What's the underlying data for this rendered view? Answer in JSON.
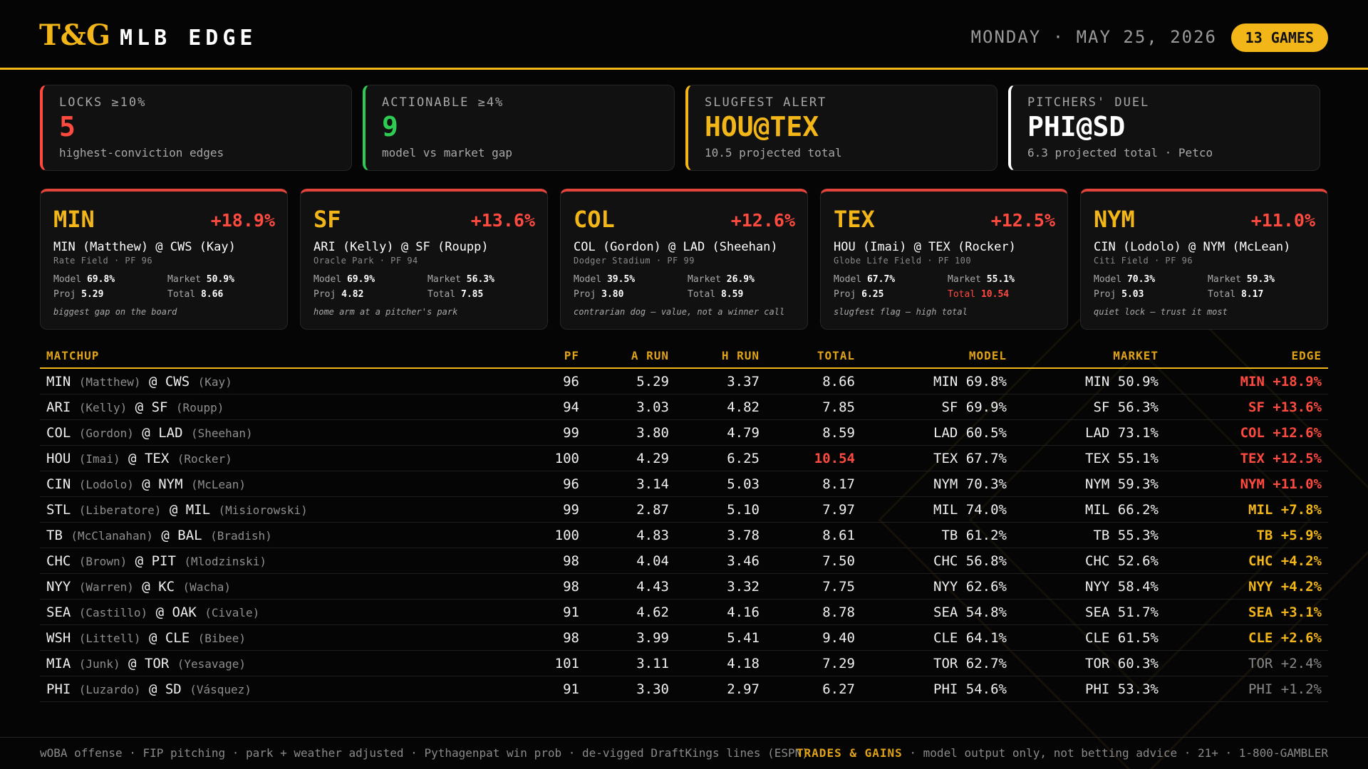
{
  "header": {
    "logo": "T&G",
    "title": "MLB EDGE",
    "date": "MONDAY · MAY 25, 2026",
    "games_badge": "13 GAMES"
  },
  "stats": [
    {
      "label": "LOCKS ≥10%",
      "value": "5",
      "sub": "highest-conviction edges",
      "color": "#ff4a40"
    },
    {
      "label": "ACTIONABLE ≥4%",
      "value": "9",
      "sub": "model vs market gap",
      "color": "#2ecc52"
    },
    {
      "label": "SLUGFEST ALERT",
      "value": "HOU@TEX",
      "sub": "10.5 projected total",
      "color": "#f2b619"
    },
    {
      "label": "PITCHERS' DUEL",
      "value": "PHI@SD",
      "sub": "6.3 projected total · Petco",
      "color": "#ffffff"
    }
  ],
  "cards": [
    {
      "team": "MIN",
      "edge": "+18.9%",
      "match": "MIN (Matthew) @ CWS (Kay)",
      "venue": "Rate Field · PF 96",
      "model_label": "Model",
      "model": "69.8%",
      "market_label": "Market",
      "market": "50.9%",
      "proj_label": "Proj",
      "proj": "5.29",
      "total_label": "Total",
      "total": "8.66",
      "note": "biggest gap on the board"
    },
    {
      "team": "SF",
      "edge": "+13.6%",
      "match": "ARI (Kelly) @ SF (Roupp)",
      "venue": "Oracle Park · PF 94",
      "model_label": "Model",
      "model": "69.9%",
      "market_label": "Market",
      "market": "56.3%",
      "proj_label": "Proj",
      "proj": "4.82",
      "total_label": "Total",
      "total": "7.85",
      "note": "home arm at a pitcher's park"
    },
    {
      "team": "COL",
      "edge": "+12.6%",
      "match": "COL (Gordon) @ LAD (Sheehan)",
      "venue": "Dodger Stadium · PF 99",
      "model_label": "Model",
      "model": "39.5%",
      "market_label": "Market",
      "market": "26.9%",
      "proj_label": "Proj",
      "proj": "3.80",
      "total_label": "Total",
      "total": "8.59",
      "note": "contrarian dog — value, not a winner call"
    },
    {
      "team": "TEX",
      "edge": "+12.5%",
      "match": "HOU (Imai) @ TEX (Rocker)",
      "venue": "Globe Life Field · PF 100",
      "model_label": "Model",
      "model": "67.7%",
      "market_label": "Market",
      "market": "55.1%",
      "proj_label": "Proj",
      "proj": "6.25",
      "total_label": "Total",
      "total": "10.54",
      "note": "slugfest flag — high total",
      "total_red": true
    },
    {
      "team": "NYM",
      "edge": "+11.0%",
      "match": "CIN (Lodolo) @ NYM (McLean)",
      "venue": "Citi Field · PF 96",
      "model_label": "Model",
      "model": "70.3%",
      "market_label": "Market",
      "market": "59.3%",
      "proj_label": "Proj",
      "proj": "5.03",
      "total_label": "Total",
      "total": "8.17",
      "note": "quiet lock — trust it most"
    }
  ],
  "table": {
    "headers": {
      "matchup": "MATCHUP",
      "pf": "PF",
      "a_run": "A RUN",
      "h_run": "H RUN",
      "total": "TOTAL",
      "model": "MODEL",
      "market": "MARKET",
      "edge": "EDGE"
    },
    "rows": [
      {
        "away": "MIN",
        "away_p": "(Matthew)",
        "at": "@",
        "home": "CWS",
        "home_p": "(Kay)",
        "pf": "96",
        "a_run": "5.29",
        "h_run": "3.37",
        "total": "8.66",
        "model": "MIN 69.8%",
        "market": "MIN 50.9%",
        "edge": "MIN +18.9%",
        "tier": "red"
      },
      {
        "away": "ARI",
        "away_p": "(Kelly)",
        "at": "@",
        "home": "SF",
        "home_p": "(Roupp)",
        "pf": "94",
        "a_run": "3.03",
        "h_run": "4.82",
        "total": "7.85",
        "model": "SF 69.9%",
        "market": "SF 56.3%",
        "edge": "SF +13.6%",
        "tier": "red"
      },
      {
        "away": "COL",
        "away_p": "(Gordon)",
        "at": "@",
        "home": "LAD",
        "home_p": "(Sheehan)",
        "pf": "99",
        "a_run": "3.80",
        "h_run": "4.79",
        "total": "8.59",
        "model": "LAD 60.5%",
        "market": "LAD 73.1%",
        "edge": "COL +12.6%",
        "tier": "red"
      },
      {
        "away": "HOU",
        "away_p": "(Imai)",
        "at": "@",
        "home": "TEX",
        "home_p": "(Rocker)",
        "pf": "100",
        "a_run": "4.29",
        "h_run": "6.25",
        "total": "10.54",
        "model": "TEX 67.7%",
        "market": "TEX 55.1%",
        "edge": "TEX +12.5%",
        "tier": "red",
        "total_red": true
      },
      {
        "away": "CIN",
        "away_p": "(Lodolo)",
        "at": "@",
        "home": "NYM",
        "home_p": "(McLean)",
        "pf": "96",
        "a_run": "3.14",
        "h_run": "5.03",
        "total": "8.17",
        "model": "NYM 70.3%",
        "market": "NYM 59.3%",
        "edge": "NYM +11.0%",
        "tier": "red"
      },
      {
        "away": "STL",
        "away_p": "(Liberatore)",
        "at": "@",
        "home": "MIL",
        "home_p": "(Misiorowski)",
        "pf": "99",
        "a_run": "2.87",
        "h_run": "5.10",
        "total": "7.97",
        "model": "MIL 74.0%",
        "market": "MIL 66.2%",
        "edge": "MIL +7.8%",
        "tier": "gold"
      },
      {
        "away": "TB",
        "away_p": "(McClanahan)",
        "at": "@",
        "home": "BAL",
        "home_p": "(Bradish)",
        "pf": "100",
        "a_run": "4.83",
        "h_run": "3.78",
        "total": "8.61",
        "model": "TB 61.2%",
        "market": "TB 55.3%",
        "edge": "TB +5.9%",
        "tier": "gold"
      },
      {
        "away": "CHC",
        "away_p": "(Brown)",
        "at": "@",
        "home": "PIT",
        "home_p": "(Mlodzinski)",
        "pf": "98",
        "a_run": "4.04",
        "h_run": "3.46",
        "total": "7.50",
        "model": "CHC 56.8%",
        "market": "CHC 52.6%",
        "edge": "CHC +4.2%",
        "tier": "gold"
      },
      {
        "away": "NYY",
        "away_p": "(Warren)",
        "at": "@",
        "home": "KC",
        "home_p": "(Wacha)",
        "pf": "98",
        "a_run": "4.43",
        "h_run": "3.32",
        "total": "7.75",
        "model": "NYY 62.6%",
        "market": "NYY 58.4%",
        "edge": "NYY +4.2%",
        "tier": "gold"
      },
      {
        "away": "SEA",
        "away_p": "(Castillo)",
        "at": "@",
        "home": "OAK",
        "home_p": "(Civale)",
        "pf": "91",
        "a_run": "4.62",
        "h_run": "4.16",
        "total": "8.78",
        "model": "SEA 54.8%",
        "market": "SEA 51.7%",
        "edge": "SEA +3.1%",
        "tier": "gold"
      },
      {
        "away": "WSH",
        "away_p": "(Littell)",
        "at": "@",
        "home": "CLE",
        "home_p": "(Bibee)",
        "pf": "98",
        "a_run": "3.99",
        "h_run": "5.41",
        "total": "9.40",
        "model": "CLE 64.1%",
        "market": "CLE 61.5%",
        "edge": "CLE +2.6%",
        "tier": "gold"
      },
      {
        "away": "MIA",
        "away_p": "(Junk)",
        "at": "@",
        "home": "TOR",
        "home_p": "(Yesavage)",
        "pf": "101",
        "a_run": "3.11",
        "h_run": "4.18",
        "total": "7.29",
        "model": "TOR 62.7%",
        "market": "TOR 60.3%",
        "edge": "TOR +2.4%",
        "tier": "gray"
      },
      {
        "away": "PHI",
        "away_p": "(Luzardo)",
        "at": "@",
        "home": "SD",
        "home_p": "(Vásquez)",
        "pf": "91",
        "a_run": "3.30",
        "h_run": "2.97",
        "total": "6.27",
        "model": "PHI 54.6%",
        "market": "PHI 53.3%",
        "edge": "PHI +1.2%",
        "tier": "gray"
      }
    ]
  },
  "footer": {
    "left": "wOBA offense · FIP pitching · park + weather adjusted · Pythagenpat win prob · de-vigged DraftKings lines (ESPN)",
    "brand": "TRADES & GAINS",
    "right": " · model output only, not betting advice · 21+ · 1-800-GAMBLER"
  },
  "colors": {
    "accent": "#f2b619",
    "red": "#ff4a40",
    "green": "#2ecc52",
    "background": "#050505"
  }
}
